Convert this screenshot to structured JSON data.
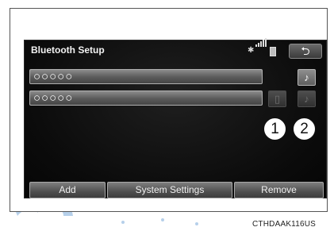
{
  "screen": {
    "title": "Bluetooth Setup",
    "status_icons": [
      "bluetooth-icon",
      "signal-icon",
      "battery-icon"
    ],
    "back_icon": "back-arrow-icon"
  },
  "devices": [
    {
      "name": "○○○○○",
      "phone_connected": false,
      "audio_connected": true
    },
    {
      "name": "○○○○○",
      "phone_connected": false,
      "audio_connected": false
    }
  ],
  "callouts": [
    "1",
    "2"
  ],
  "buttons": {
    "add": "Add",
    "system_settings": "System Settings",
    "remove": "Remove"
  },
  "caption": "CTHDAAK116US",
  "colors": {
    "screen_bg": "#0b0b0b",
    "button_face": "#5a5a5a",
    "text": "#ffffff"
  }
}
